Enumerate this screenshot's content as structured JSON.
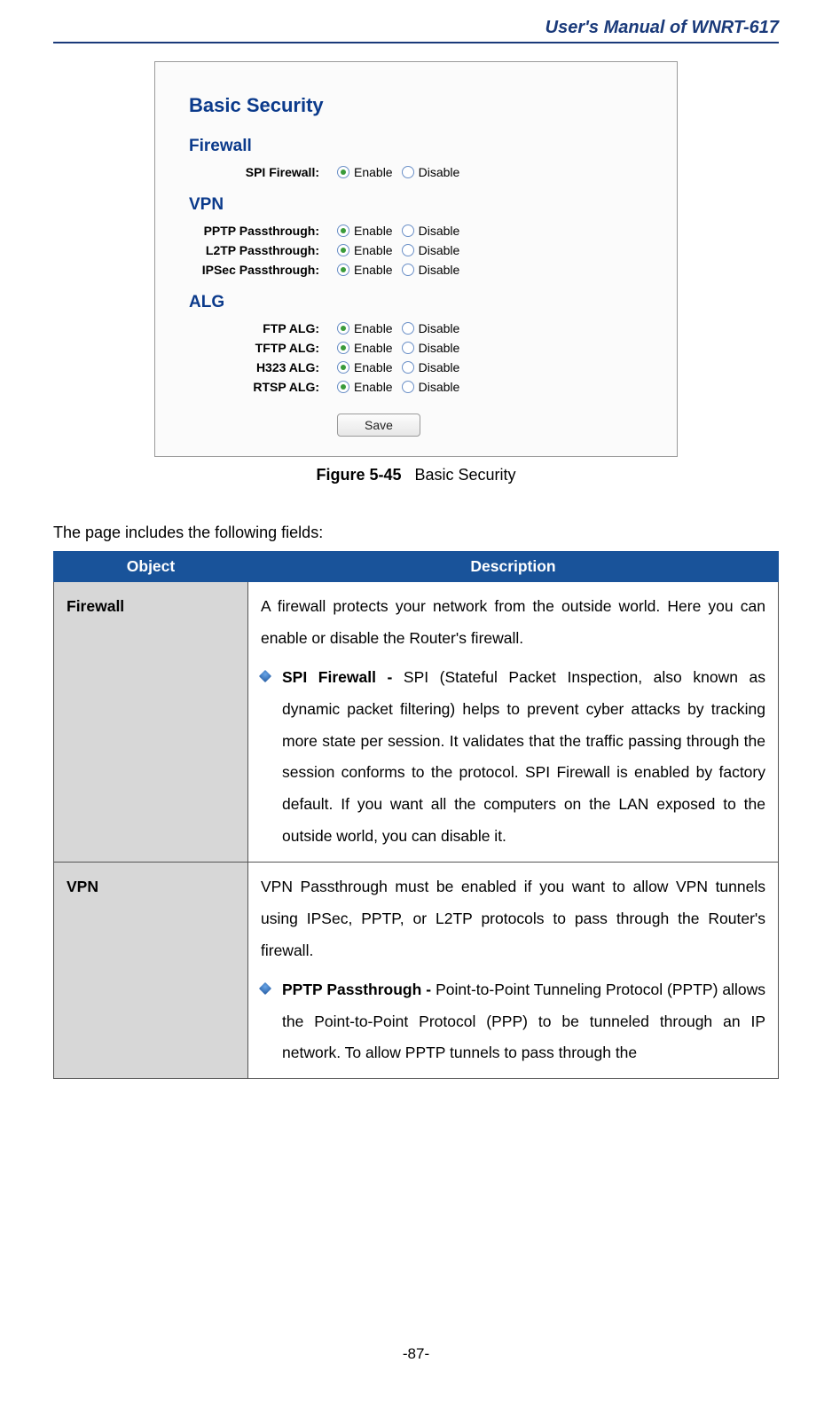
{
  "header": {
    "title": "User's Manual of WNRT-617"
  },
  "screenshot": {
    "title": "Basic Security",
    "sections": {
      "firewall": {
        "heading": "Firewall",
        "rows": [
          {
            "label": "SPI Firewall:",
            "enable": "Enable",
            "disable": "Disable",
            "selected": "enable"
          }
        ]
      },
      "vpn": {
        "heading": "VPN",
        "rows": [
          {
            "label": "PPTP Passthrough:",
            "enable": "Enable",
            "disable": "Disable",
            "selected": "enable"
          },
          {
            "label": "L2TP Passthrough:",
            "enable": "Enable",
            "disable": "Disable",
            "selected": "enable"
          },
          {
            "label": "IPSec Passthrough:",
            "enable": "Enable",
            "disable": "Disable",
            "selected": "enable"
          }
        ]
      },
      "alg": {
        "heading": "ALG",
        "rows": [
          {
            "label": "FTP ALG:",
            "enable": "Enable",
            "disable": "Disable",
            "selected": "enable"
          },
          {
            "label": "TFTP ALG:",
            "enable": "Enable",
            "disable": "Disable",
            "selected": "enable"
          },
          {
            "label": "H323 ALG:",
            "enable": "Enable",
            "disable": "Disable",
            "selected": "enable"
          },
          {
            "label": "RTSP ALG:",
            "enable": "Enable",
            "disable": "Disable",
            "selected": "enable"
          }
        ]
      }
    },
    "save_label": "Save"
  },
  "figure": {
    "number": "Figure 5-45",
    "caption": "Basic Security"
  },
  "intro": "The page includes the following fields:",
  "table": {
    "headers": {
      "object": "Object",
      "description": "Description"
    },
    "rows": [
      {
        "object": "Firewall",
        "desc_intro": "A firewall protects your network from the outside world. Here you can enable or disable the Router's firewall.",
        "bullets": [
          {
            "head": "SPI Firewall - ",
            "body": "SPI (Stateful Packet Inspection, also known as dynamic packet filtering) helps to prevent cyber attacks by tracking more state per session. It validates that the traffic passing through the session conforms to the protocol. SPI Firewall is enabled by factory default. If you want all the computers on the LAN exposed to the outside world, you can disable it."
          }
        ]
      },
      {
        "object": "VPN",
        "desc_intro": "VPN Passthrough must be enabled if you want to allow VPN tunnels using IPSec, PPTP, or L2TP protocols to pass through the Router's firewall.",
        "bullets": [
          {
            "head": "PPTP Passthrough - ",
            "body": "Point-to-Point Tunneling Protocol (PPTP) allows the Point-to-Point Protocol (PPP) to be tunneled through an IP network. To allow PPTP tunnels to pass through the"
          }
        ]
      }
    ]
  },
  "page_number": "-87-"
}
